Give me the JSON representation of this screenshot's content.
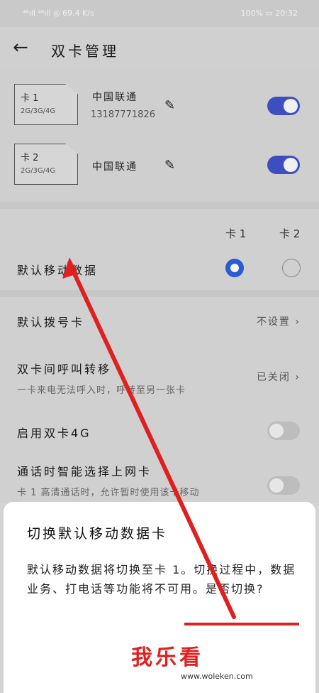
{
  "status_bar": {
    "left": "⁴⁶ıll ⁴⁶ıll ◎ 69.4 K/s",
    "right": "100% ▭ 20:32"
  },
  "header": {
    "back_icon": "←",
    "title": "双卡管理"
  },
  "sims": [
    {
      "name": "卡 1",
      "type": "2G/3G/4G",
      "carrier": "中国联通",
      "phone": "13187771826",
      "enabled": true
    },
    {
      "name": "卡 2",
      "type": "2G/3G/4G",
      "carrier": "中国联通",
      "phone": "",
      "enabled": true
    }
  ],
  "default_data": {
    "col1": "卡 1",
    "col2": "卡 2",
    "label": "默认移动数据",
    "selected": "卡 1"
  },
  "settings": {
    "dial_label": "默认拨号卡",
    "dial_value": "不设置",
    "forward_label": "双卡间呼叫转移",
    "forward_sub": "一卡来电无法呼入时，呼转至另一张卡",
    "forward_value": "已关闭",
    "dual4g_label": "启用双卡4G",
    "smart_label": "通话时智能选择上网卡",
    "smart_sub": "卡 1 高清通话时，允许暂时使用该卡移动"
  },
  "dialog": {
    "title": "切换默认移动数据卡",
    "body": "默认移动数据将切换至卡 1。切换过程中，数据业务、打电话等功能将不可用。是否切换?"
  },
  "watermark": {
    "text": "我乐看",
    "url": "www.woleken.com"
  },
  "colors": {
    "accent": "#3d4fc0",
    "arrow": "#e02020"
  }
}
